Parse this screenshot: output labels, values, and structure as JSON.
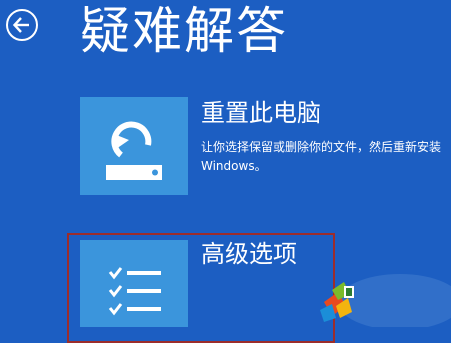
{
  "header": {
    "back_icon": "arrow-left-circle-icon",
    "title": "疑难解答"
  },
  "options": [
    {
      "icon": "refresh-drive-icon",
      "title": "重置此电脑",
      "description": "让你选择保留或删除你的文件，然后重新安装 Windows。"
    },
    {
      "icon": "checklist-icon",
      "title": "高级选项"
    }
  ],
  "colors": {
    "background": "#1c5ec2",
    "tile": "#3b95dc",
    "text": "#ffffff",
    "highlight_frame": "#9c2d2b"
  }
}
